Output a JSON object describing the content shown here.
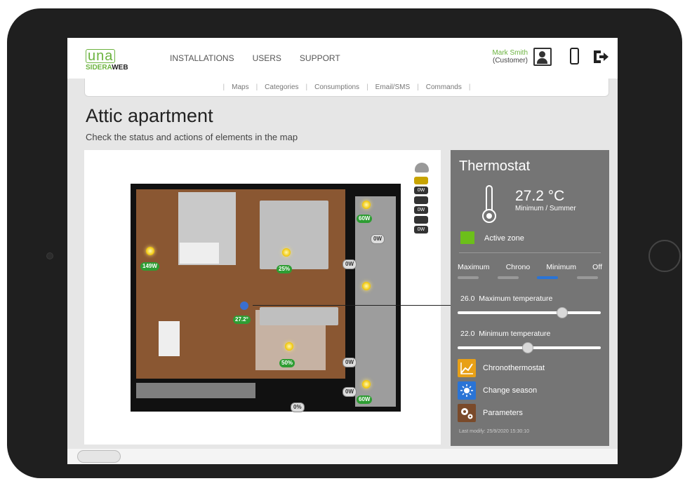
{
  "brand": {
    "line1": "una",
    "line2a": "SIDERA",
    "line2b": "WEB"
  },
  "nav": [
    "INSTALLATIONS",
    "USERS",
    "SUPPORT"
  ],
  "user": {
    "name": "Mark Smith",
    "role": "(Customer)"
  },
  "subnav": [
    "Maps",
    "Categories",
    "Consumptions",
    "Email/SMS",
    "Commands"
  ],
  "page": {
    "title": "Attic apartment",
    "subtitle": "Check the status and actions of elements in the map"
  },
  "map": {
    "badges": [
      "149W",
      "25%",
      "27.2°",
      "50%",
      "0%",
      "60W",
      "0W",
      "0W",
      "0W",
      "60W",
      "0W"
    ],
    "side_badges": [
      "0W",
      "0W",
      "0W"
    ]
  },
  "thermostat": {
    "title": "Thermostat",
    "temperature": "27.2 °C",
    "mode_summary": "Minimum / Summer",
    "active_zone": "Active zone",
    "modes": [
      "Maximum",
      "Chrono",
      "Minimum",
      "Off"
    ],
    "selected_mode": "Minimum",
    "max": {
      "value": "26.0",
      "label": "Maximum temperature",
      "level": 0.73
    },
    "min": {
      "value": "22.0",
      "label": "Minimum temperature",
      "level": 0.49
    },
    "actions": [
      {
        "label": "Chronothermostat",
        "color": "#e8a017",
        "icon": "chart-icon"
      },
      {
        "label": "Change season",
        "color": "#2a74d6",
        "icon": "sun-icon"
      },
      {
        "label": "Parameters",
        "color": "#7a4a2a",
        "icon": "gears-icon"
      }
    ],
    "last_modify": "Last modify: 25/9/2020 15:30:10"
  },
  "colors": {
    "accent": "#6cb33f",
    "panel": "#757575",
    "active_zone": "#6cbf1a"
  }
}
